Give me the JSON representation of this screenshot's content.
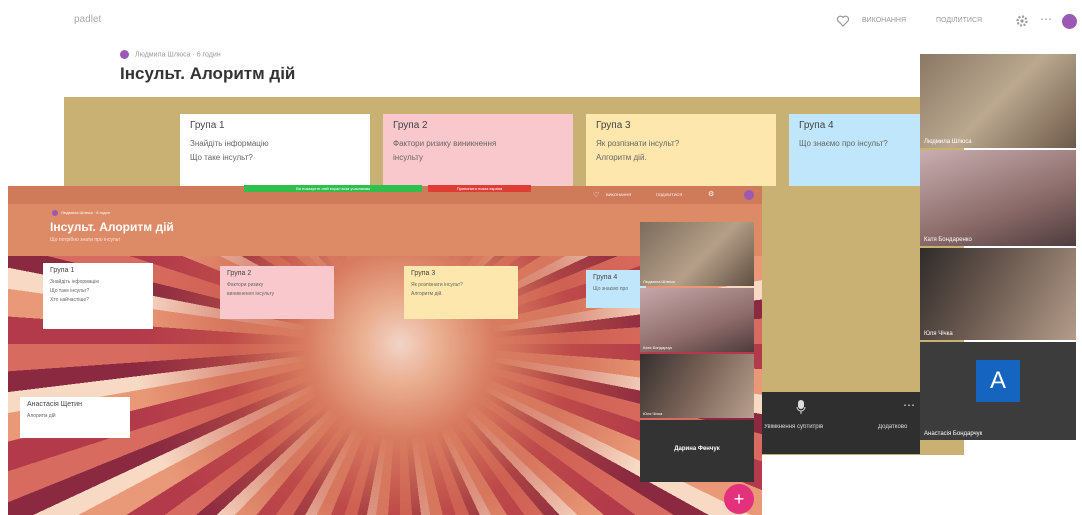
{
  "app": {
    "logo": "padlet"
  },
  "colors": {
    "accent": "#9b59b6",
    "board_bg": "#c9b173",
    "front_head": "#dd8a66",
    "fab": "#e4317b"
  },
  "back_window": {
    "breadcrumb": "Людмила Шлюса · 6 годин",
    "title": "Інсульт. Алоритм дій",
    "top_actions": {
      "remix": "ВИКОНАННЯ",
      "share": "ПОДІЛИТИСЯ"
    },
    "notes": [
      {
        "title": "Група 1",
        "lines": [
          "Знайдіть інформацію",
          "Що таке інсульт?"
        ]
      },
      {
        "title": "Група 2",
        "lines": [
          "Фактори ризику виникнення",
          "інсульту"
        ]
      },
      {
        "title": "Група 3",
        "lines": [
          "Як розпізнати інсульт?",
          "Алгоритм дій."
        ]
      },
      {
        "title": "Група 4",
        "lines": [
          "Що знаємо про інсульт?"
        ]
      }
    ]
  },
  "front_window": {
    "title": "Інсульт. Алоритм дій",
    "subtitle": "Що потрібно знати про інсульт",
    "breadcrumb": "Людмила Шлюса · 6 годин",
    "top_actions": {
      "remix": "ВИКОНАННЯ",
      "share": "ПОДІЛИТИСЯ"
    },
    "share_banner_green": "Ви показуєте свій екран всім учасникам",
    "share_banner_red": "Припинити показ екрана",
    "notes": [
      {
        "title": "Група 1",
        "lines": [
          "Знайдіть інформацію",
          "Що таке інсульт?",
          "Хто найчастіше?"
        ]
      },
      {
        "title": "Група 2",
        "lines": [
          "Фактори ризику",
          "виникнення інсульту"
        ]
      },
      {
        "title": "Група 3",
        "lines": [
          "Як розпізнати інсульт?",
          "Алгоритм дій."
        ]
      },
      {
        "title": "Група 4",
        "lines": [
          "Що знаємо про"
        ]
      },
      {
        "title": "Анастасія Щетин",
        "lines": [
          "Алоритм дій"
        ]
      }
    ],
    "participants": [
      {
        "name": "Людмила Шлюса"
      },
      {
        "name": "Катя Бондарчук"
      },
      {
        "name": "Юля Чічка"
      },
      {
        "name": "Дарина Фенчук"
      }
    ]
  },
  "meet_panel": {
    "participants": [
      {
        "name": "Людмила Шлюса"
      },
      {
        "name": "Катя Бондаренко"
      },
      {
        "name": "Юля Чічка"
      },
      {
        "name": "Анастасія Бондарчук",
        "avatar_letter": "A"
      }
    ],
    "controls": {
      "captions": "Увімкнення субтитрів",
      "more": "Додатково"
    }
  }
}
